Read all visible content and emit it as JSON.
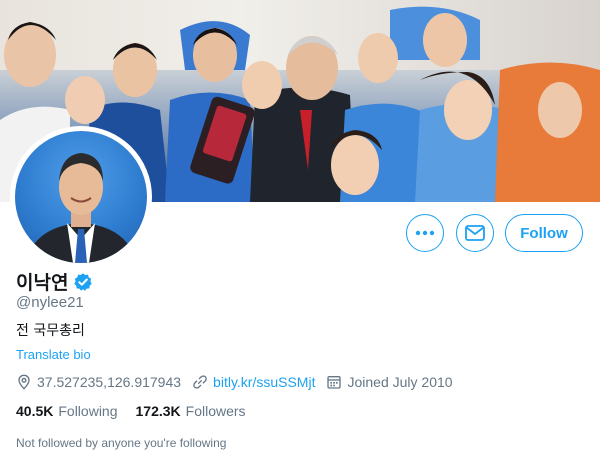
{
  "profile": {
    "name": "이낙연",
    "handle": "@nylee21",
    "bio": "전 국무총리",
    "translate_label": "Translate bio",
    "verified": true
  },
  "meta": {
    "location": "37.527235,126.917943",
    "website": "bitly.kr/ssuSSMjt",
    "joined": "Joined July 2010"
  },
  "stats": {
    "following_count": "40.5K",
    "following_label": "Following",
    "followers_count": "172.3K",
    "followers_label": "Followers"
  },
  "actions": {
    "more_icon": "more-icon",
    "message_icon": "envelope-icon",
    "follow_label": "Follow"
  },
  "footer": {
    "not_followed": "Not followed by anyone you're following"
  },
  "colors": {
    "accent": "#1da1f2",
    "text_primary": "#14171a",
    "text_secondary": "#657786"
  }
}
